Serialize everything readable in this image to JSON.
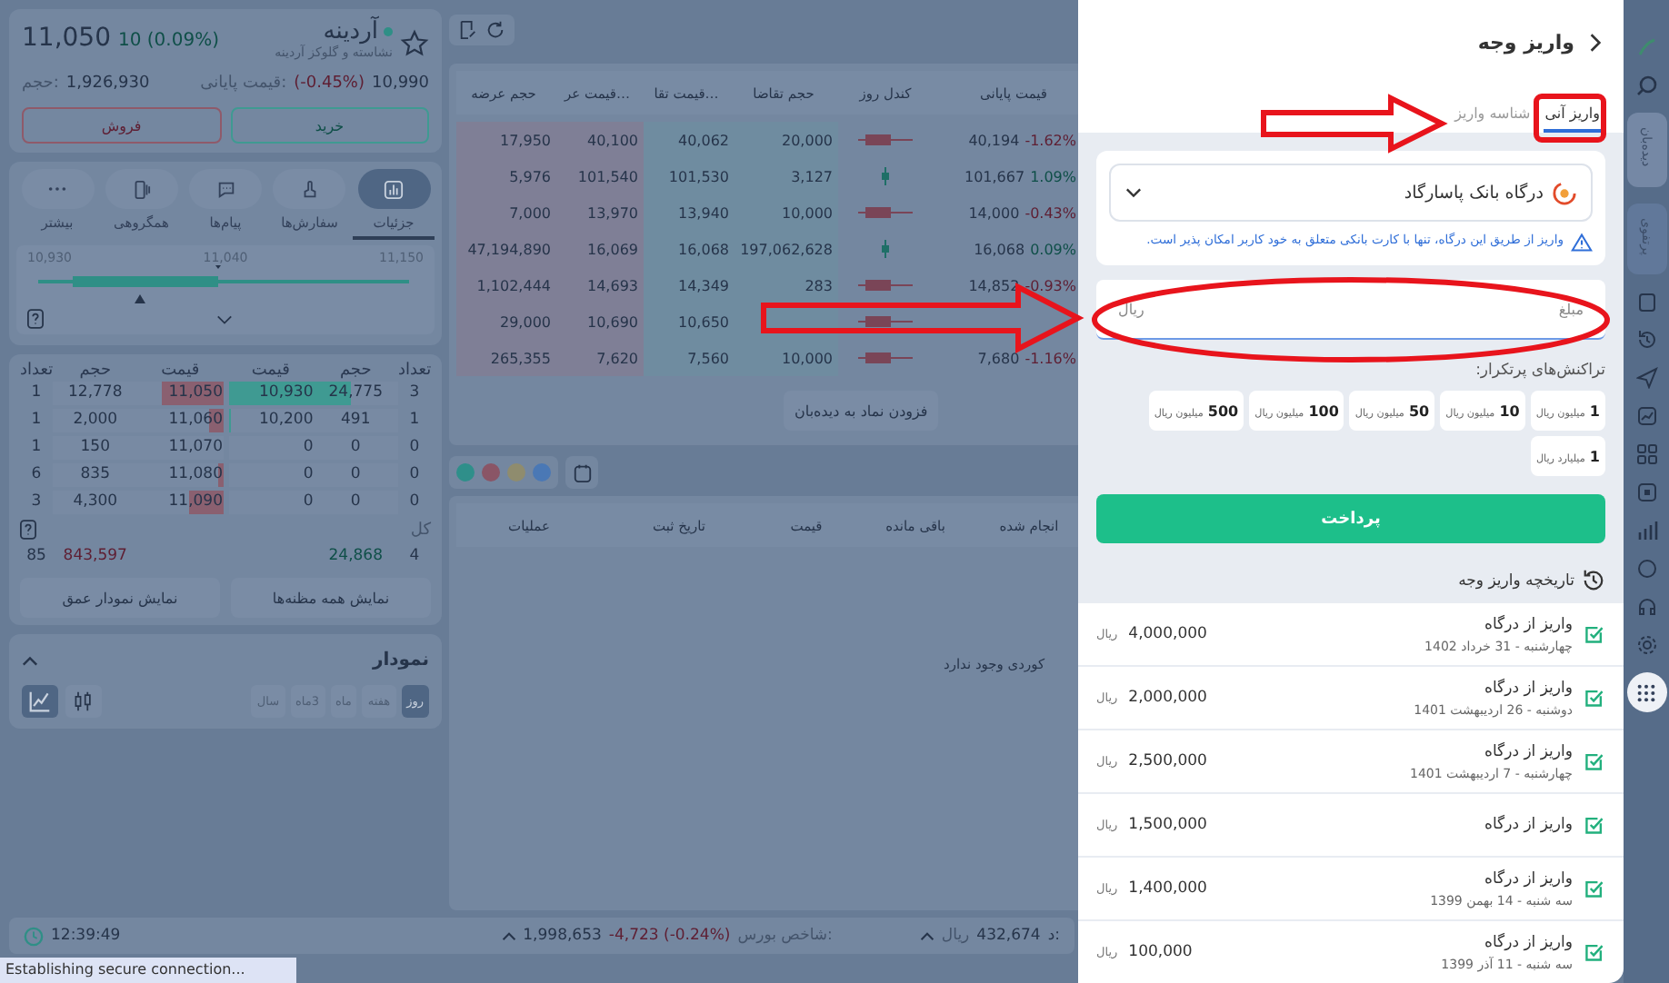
{
  "symbol": {
    "name": "آردینه",
    "subtitle": "نشاسته و گلوکز آردینه",
    "price": "11,050",
    "change": "10 (0.09%)",
    "close_label": "قیمت پایانی:",
    "close_price": "10,990",
    "close_change": "(-0.45%)",
    "volume_label": "حجم:",
    "volume": "1,926,930",
    "buy_button": "خرید",
    "sell_button": "فروش"
  },
  "detail_tabs": [
    {
      "label": "جزئیات",
      "kind": "details",
      "selected": true
    },
    {
      "label": "سفارش‌ها",
      "kind": "orders",
      "selected": false
    },
    {
      "label": "پیام‌ها",
      "kind": "messages",
      "selected": false
    },
    {
      "label": "همگروهی",
      "kind": "peers",
      "selected": false
    },
    {
      "label": "بیشتر",
      "kind": "more",
      "selected": false
    }
  ],
  "range": {
    "low": "10,930",
    "mid": "11,040",
    "high": "11,150"
  },
  "order_book": {
    "buy_headers": [
      "تعداد",
      "حجم",
      "قیمت"
    ],
    "sell_headers": [
      "قیمت",
      "حجم",
      "تعداد"
    ],
    "rows": [
      {
        "buy": {
          "count": "3",
          "volume": "24,775",
          "price": "10,930",
          "level": 0.72
        },
        "sell": {
          "price": "11,050",
          "volume": "12,778",
          "count": "1",
          "level": 0.36
        }
      },
      {
        "buy": {
          "count": "1",
          "volume": "491",
          "price": "10,200",
          "level": 0.01
        },
        "sell": {
          "price": "11,060",
          "volume": "2,000",
          "count": "1",
          "level": 0.08
        }
      },
      {
        "buy": {
          "count": "0",
          "volume": "0",
          "price": "0"
        },
        "sell": {
          "price": "11,070",
          "volume": "150",
          "count": "1"
        }
      },
      {
        "buy": {
          "count": "0",
          "volume": "0",
          "price": "0"
        },
        "sell": {
          "price": "11,080",
          "volume": "835",
          "count": "6",
          "level": 0.03
        }
      },
      {
        "buy": {
          "count": "0",
          "volume": "0",
          "price": "0"
        },
        "sell": {
          "price": "11,090",
          "volume": "4,300",
          "count": "3",
          "level": 0.2
        }
      }
    ],
    "total_label": "کل",
    "buy_total_count": "4",
    "buy_total_volume": "24,868",
    "sell_total_volume": "843,597",
    "sell_total_count": "85",
    "all_quotes_button": "نمایش همه مظنه‌ها",
    "depth_chart_button": "نمایش نمودار عمق"
  },
  "chart_card": {
    "title": "نمودار",
    "periods": [
      {
        "label": "روز",
        "selected": true
      },
      {
        "label": "هفته",
        "selected": false
      },
      {
        "label": "ماه",
        "selected": false
      },
      {
        "label": "3ماه",
        "selected": false
      },
      {
        "label": "سال",
        "selected": false
      }
    ],
    "views": [
      {
        "kind": "line",
        "selected": true
      },
      {
        "kind": "candles",
        "selected": false
      }
    ]
  },
  "watchlist": {
    "columns": [
      "قیمت پایانی",
      "کندل روز",
      "حجم تقاضا",
      "قیمت تقا…",
      "قیمت عر…",
      "حجم عرضه"
    ],
    "rows": [
      {
        "last_price": "40,194",
        "change": "-1.62%",
        "kind": "down",
        "bid_volume": "20,000",
        "bid_price": "40,062",
        "ask_price": "40,100",
        "ask_volume": "17,950"
      },
      {
        "last_price": "101,667",
        "change": "1.09%",
        "kind": "up",
        "bid_volume": "3,127",
        "bid_price": "101,530",
        "ask_price": "101,540",
        "ask_volume": "5,976"
      },
      {
        "last_price": "14,000",
        "change": "-0.43%",
        "kind": "down",
        "bid_volume": "10,000",
        "bid_price": "13,940",
        "ask_price": "13,970",
        "ask_volume": "7,000"
      },
      {
        "last_price": "16,068",
        "change": "0.09%",
        "kind": "up",
        "bid_volume": "197,062,628",
        "bid_price": "16,068",
        "ask_price": "16,069",
        "ask_volume": "47,194,890"
      },
      {
        "last_price": "14,852",
        "change": "-0.93%",
        "kind": "down",
        "bid_volume": "283",
        "bid_price": "14,349",
        "ask_price": "14,693",
        "ask_volume": "1,102,444"
      },
      {
        "kind": "down",
        "bid_price": "10,650",
        "ask_price": "10,690",
        "ask_volume": "29,000"
      },
      {
        "last_price": "7,680",
        "change": "-1.16%",
        "kind": "down",
        "bid_volume": "10,000",
        "bid_price": "7,560",
        "ask_price": "7,620",
        "ask_volume": "265,355"
      }
    ],
    "add_button": "فزودن نماد به دیده‌بان"
  },
  "orders": {
    "filters": [
      {
        "color": "#2f8f8a"
      },
      {
        "color": "#8a5566"
      },
      {
        "color": "#8f8c6e"
      },
      {
        "color": "#4a78b5"
      }
    ],
    "columns": [
      "انجام شده",
      "باقی مانده",
      "قیمت",
      "تاریخ ثبت",
      "عملیات"
    ],
    "empty_message": "کوردی وجود ندارد"
  },
  "status_bar": {
    "time": "12:39:49",
    "index_value": "1,998,653",
    "index_change": "-4,723 (-0.24%)",
    "index_label": "شاخص بورس:",
    "balance_label": "د:",
    "balance": "432,674",
    "balance_unit": "ریال"
  },
  "deposit": {
    "title": "واریز وجه",
    "tabs": [
      {
        "label": "واریز آنی",
        "selected": true
      },
      {
        "label": "شناسه واریز",
        "selected": false
      }
    ],
    "gateway": "درگاه بانک پاسارگاد",
    "warning": "واریز از طریق این درگاه، تنها با کارت بانکی متعلق به خود کاربر امکان پذیر است.",
    "amount_placeholder": "مبلغ",
    "amount_unit": "ریال",
    "presets_label": "تراکنش‌های پرتکرار:",
    "presets": [
      {
        "amount": "1",
        "unit": "میلیون ریال"
      },
      {
        "amount": "10",
        "unit": "میلیون ریال"
      },
      {
        "amount": "50",
        "unit": "میلیون ریال"
      },
      {
        "amount": "100",
        "unit": "میلیون ریال"
      },
      {
        "amount": "500",
        "unit": "میلیون ریال"
      },
      {
        "amount": "1",
        "unit": "میلیارد ریال"
      }
    ],
    "pay_button": "پرداخت",
    "history_title": "تاریخچه واریز وجه",
    "history": [
      {
        "title": "واریز از درگاه",
        "date": "چهارشنبه - 31 خرداد 1402",
        "amount": "4,000,000",
        "unit": "ریال",
        "done": true
      },
      {
        "title": "واریز از درگاه",
        "date": "دوشنبه - 26 اردیبهشت 1401",
        "amount": "2,000,000",
        "unit": "ریال",
        "done": true
      },
      {
        "title": "واریز از درگاه",
        "date": "چهارشنبه - 7 اردیبهشت 1401",
        "amount": "2,500,000",
        "unit": "ریال",
        "done": true
      },
      {
        "title": "واریز از درگاه",
        "amount": "1,500,000",
        "unit": "ریال",
        "done": true
      },
      {
        "title": "واریز از درگاه",
        "date": "سه شنبه - 14 بهمن 1399",
        "amount": "1,400,000",
        "unit": "ریال",
        "done": true
      },
      {
        "title": "واریز از درگاه",
        "date": "سه شنبه - 11 آذر 1399",
        "amount": "100,000",
        "unit": "ریال",
        "done": true
      }
    ]
  },
  "side_tabs": [
    {
      "label": "دیده‌بان",
      "selected": true
    },
    {
      "label": "پرتفوی",
      "selected": false
    }
  ],
  "browser_status": "Establishing secure connection..."
}
